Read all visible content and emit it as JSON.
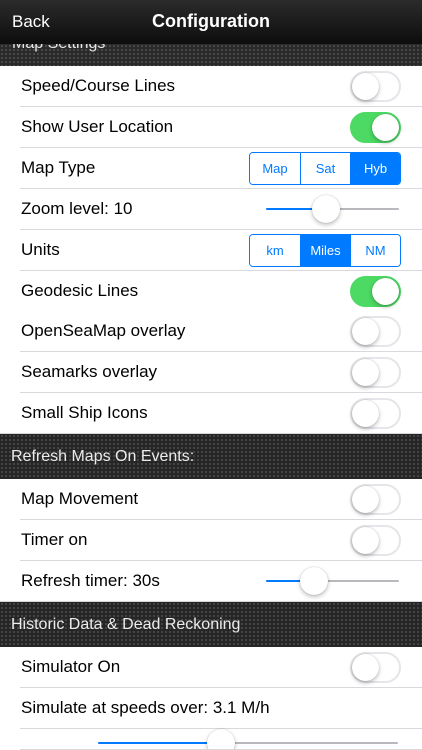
{
  "navbar": {
    "back_label": "Back",
    "title": "Configuration"
  },
  "sections": {
    "map_settings": "Map Settings",
    "refresh": "Refresh Maps On Events:",
    "historic": "Historic Data & Dead Reckoning"
  },
  "rows": {
    "speed_course": {
      "label": "Speed/Course Lines",
      "on": false
    },
    "show_location": {
      "label": "Show User Location",
      "on": true
    },
    "map_type": {
      "label": "Map Type",
      "options": [
        "Map",
        "Sat",
        "Hyb"
      ],
      "selected": "Hyb"
    },
    "zoom": {
      "label": "Zoom level: 10",
      "level": 0.45
    },
    "units": {
      "label": "Units",
      "options": [
        "km",
        "Miles",
        "NM"
      ],
      "selected": "Miles"
    },
    "geodesic": {
      "label": "Geodesic Lines",
      "on": true
    },
    "openseamap": {
      "label": "OpenSeaMap overlay",
      "on": false
    },
    "seamarks": {
      "label": "Seamarks overlay",
      "on": false
    },
    "small_ship": {
      "label": "Small Ship Icons",
      "on": false
    },
    "map_movement": {
      "label": "Map Movement",
      "on": false
    },
    "timer_on": {
      "label": "Timer on",
      "on": false
    },
    "refresh_timer": {
      "label": "Refresh timer: 30s",
      "level": 0.36
    },
    "simulator_on": {
      "label": "Simulator On",
      "on": false
    },
    "simulate_speed": {
      "label": "Simulate at speeds over: 3.1 M/h",
      "level": 0.41
    }
  },
  "colors": {
    "accent": "#007aff",
    "switch_on": "#4cd964",
    "header_bg": "#262626"
  }
}
